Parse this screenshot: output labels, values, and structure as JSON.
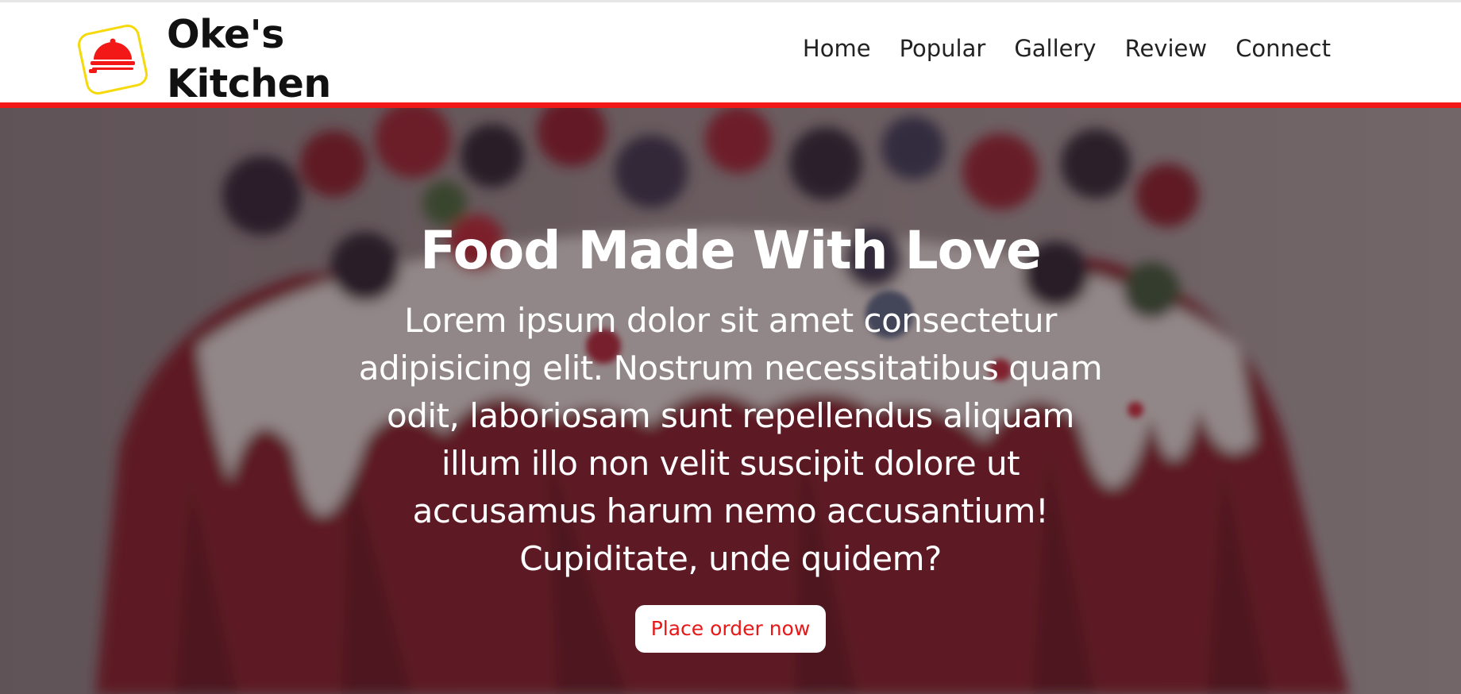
{
  "brand": {
    "line1": "Oke's",
    "line2": "Kitchen",
    "logo_icon": "cloche-icon",
    "logo_color": "#f21818",
    "logo_border_color": "#f5d90a"
  },
  "nav": {
    "items": [
      "Home",
      "Popular",
      "Gallery",
      "Review",
      "Connect"
    ]
  },
  "hero": {
    "title": "Food Made With Love",
    "text": "Lorem ipsum dolor sit amet consectetur adipisicing elit. Nostrum necessitatibus quam odit, laboriosam sunt repellendus aliquam illum illo non velit suscipit dolore ut accusamus harum nemo accusantium! Cupiditate, unde quidem?",
    "button_label": "Place order now",
    "background_image": "berry-bundt-cake-photo"
  },
  "colors": {
    "accent": "#f21818",
    "button_text": "#e81818"
  }
}
